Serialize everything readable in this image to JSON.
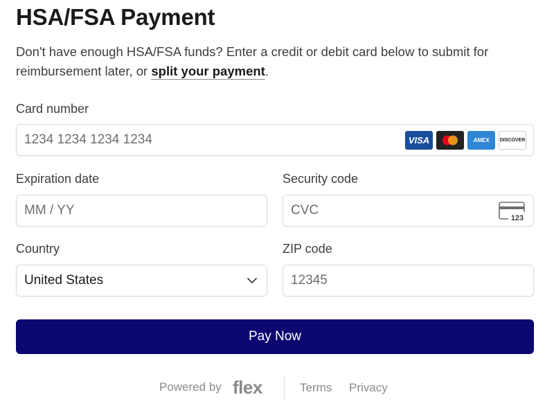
{
  "header": {
    "title": "HSA/FSA Payment",
    "intro_text": "Don't have enough HSA/FSA funds? Enter a credit or debit card below to submit for reimbursement later, or ",
    "intro_link": "split your payment",
    "intro_end": "."
  },
  "card": {
    "label": "Card number",
    "placeholder": "1234 1234 1234 1234",
    "brands": [
      "VISA",
      "mastercard",
      "AMEX",
      "DISCOVER"
    ]
  },
  "expiration": {
    "label": "Expiration date",
    "placeholder": "MM / YY"
  },
  "security": {
    "label": "Security code",
    "placeholder": "CVC",
    "icon_text": "123"
  },
  "country": {
    "label": "Country",
    "value": "United States"
  },
  "zip": {
    "label": "ZIP code",
    "placeholder": "12345"
  },
  "actions": {
    "pay_label": "Pay Now"
  },
  "footer": {
    "powered_by": "Powered by",
    "brand": "flex",
    "terms": "Terms",
    "privacy": "Privacy"
  },
  "colors": {
    "primary_button": "#0b0670",
    "visa": "#1a4d9c",
    "amex": "#2f86d4",
    "mastercard_red": "#eb001b",
    "mastercard_orange": "#f79e1b"
  }
}
